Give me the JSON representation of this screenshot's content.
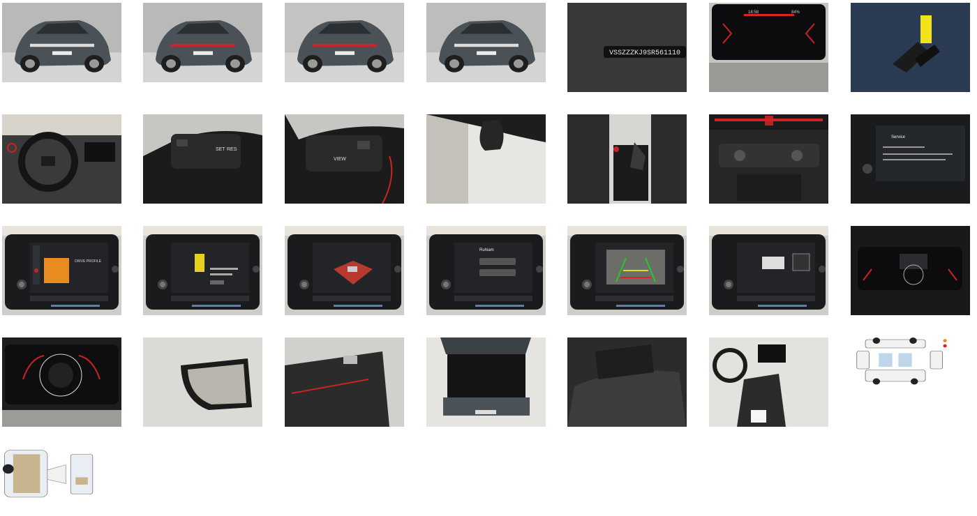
{
  "gallery": {
    "images": [
      {
        "name": "car-front-3-4-photo",
        "kind": "studio-front",
        "bg": "#b9bab8",
        "car": "#4a5257"
      },
      {
        "name": "car-rear-3-4-photo",
        "kind": "studio-rear",
        "bg": "#b9bab8",
        "car": "#4a5257"
      },
      {
        "name": "car-rear-photo",
        "kind": "studio-rear",
        "bg": "#c3c3c1",
        "car": "#4a5257"
      },
      {
        "name": "car-front-side-photo",
        "kind": "studio-front",
        "bg": "#bdbdbb",
        "car": "#4a5257"
      },
      {
        "name": "vin-plate-photo",
        "kind": "vin",
        "vin": "VSSZZZKJ9SR561110"
      },
      {
        "name": "instrument-cluster-photo",
        "kind": "cluster",
        "clock": "18:58",
        "pct": "84%"
      },
      {
        "name": "car-keys-photo",
        "kind": "keys"
      },
      {
        "name": "dashboard-steering-wheel-photo",
        "kind": "dashboard"
      },
      {
        "name": "steering-wheel-left-buttons-photo",
        "kind": "wheel-left",
        "button_a": "SET",
        "button_b": "RES"
      },
      {
        "name": "steering-wheel-right-buttons-photo",
        "kind": "wheel-right",
        "button_a": "VIEW"
      },
      {
        "name": "windshield-mirror-photo",
        "kind": "windshield"
      },
      {
        "name": "gear-selector-photo",
        "kind": "gear"
      },
      {
        "name": "climate-control-photo",
        "kind": "climate"
      },
      {
        "name": "infotainment-service-screen-photo",
        "kind": "screen-service",
        "title": "Service"
      },
      {
        "name": "infotainment-drive-mode-photo",
        "kind": "screen-orange",
        "label": "DRIVE PROFILE"
      },
      {
        "name": "infotainment-charge-screen-photo",
        "kind": "screen-yellow"
      },
      {
        "name": "infotainment-car-3d-screen-photo",
        "kind": "screen-car3d"
      },
      {
        "name": "infotainment-call-screen-photo",
        "kind": "screen-call",
        "title": "Ruhiam"
      },
      {
        "name": "infotainment-rear-camera-photo",
        "kind": "screen-camera"
      },
      {
        "name": "infotainment-park-assist-photo",
        "kind": "screen-park"
      },
      {
        "name": "digital-cockpit-photo",
        "kind": "cockpit"
      },
      {
        "name": "digital-cockpit-gauges-photo",
        "kind": "gauges"
      },
      {
        "name": "side-mirror-photo",
        "kind": "mirror"
      },
      {
        "name": "door-panel-photo",
        "kind": "door"
      },
      {
        "name": "trunk-open-photo",
        "kind": "trunk"
      },
      {
        "name": "rear-seats-photo",
        "kind": "seats"
      },
      {
        "name": "interior-front-seats-photo",
        "kind": "interior"
      },
      {
        "name": "damage-diagram-exterior",
        "kind": "diagram-ext"
      },
      {
        "name": "damage-diagram-interior",
        "kind": "diagram-int"
      }
    ]
  }
}
